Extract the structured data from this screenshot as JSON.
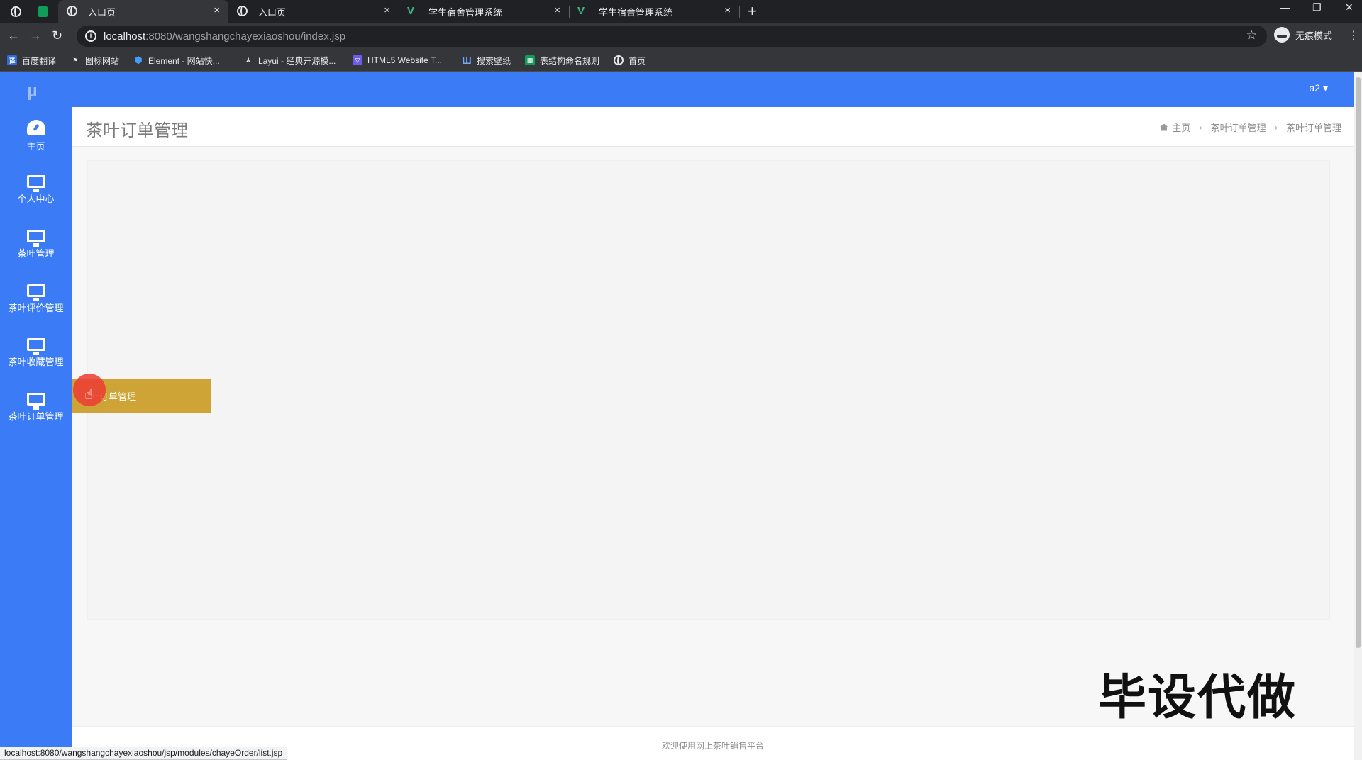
{
  "browser": {
    "tabs": [
      {
        "label": "入口页",
        "icon": "globe-icon",
        "active": true
      },
      {
        "label": "入口页",
        "icon": "globe-icon",
        "active": false
      },
      {
        "label": "学生宿舍管理系统",
        "icon": "vue-icon",
        "active": false
      },
      {
        "label": "学生宿舍管理系统",
        "icon": "vue-icon",
        "active": false
      }
    ],
    "close_glyph": "×",
    "new_tab_glyph": "+",
    "address": {
      "host": "localhost",
      "path": ":8080/wangshangchayexiaoshou/index.jsp"
    },
    "incognito_label": "无痕模式",
    "bookmarks": [
      {
        "label": "百度翻译",
        "color": "#2d6be4"
      },
      {
        "label": "图标网站",
        "color": "#202124"
      },
      {
        "label": "Element - 网站快...",
        "color": "#409eff"
      },
      {
        "label": "Layui - 经典开源模...",
        "color": "#202124"
      },
      {
        "label": "HTML5 Website T...",
        "color": "#6c5ce7"
      },
      {
        "label": "搜索壁纸",
        "color": "#3a7bd5"
      },
      {
        "label": "表结构命名规则",
        "color": "#0f9d58"
      },
      {
        "label": "首页",
        "color": "#202124"
      }
    ],
    "status_url": "localhost:8080/wangshangchayexiaoshou/jsp/modules/chayeOrder/list.jsp"
  },
  "app": {
    "brand_color": "#3b7cf6",
    "logo_text": "μ",
    "user_menu": "a2 ▾",
    "sidebar": [
      {
        "label": "主页",
        "icon": "dashboard-icon"
      },
      {
        "label": "个人中心",
        "icon": "monitor-icon"
      },
      {
        "label": "茶叶管理",
        "icon": "monitor-icon"
      },
      {
        "label": "茶叶评价管理",
        "icon": "monitor-icon"
      },
      {
        "label": "茶叶收藏管理",
        "icon": "monitor-icon"
      },
      {
        "label": "茶叶订单管理",
        "icon": "monitor-icon"
      }
    ],
    "page_title": "茶叶订单管理",
    "breadcrumb": [
      "主页",
      "茶叶订单管理",
      "茶叶订单管理"
    ],
    "breadcrumb_sep": "›",
    "flyout_item": "叶订单管理",
    "flyout_color": "#cfa436",
    "footer_text": "欢迎使用网上茶叶销售平台",
    "watermark": "毕设代做"
  }
}
